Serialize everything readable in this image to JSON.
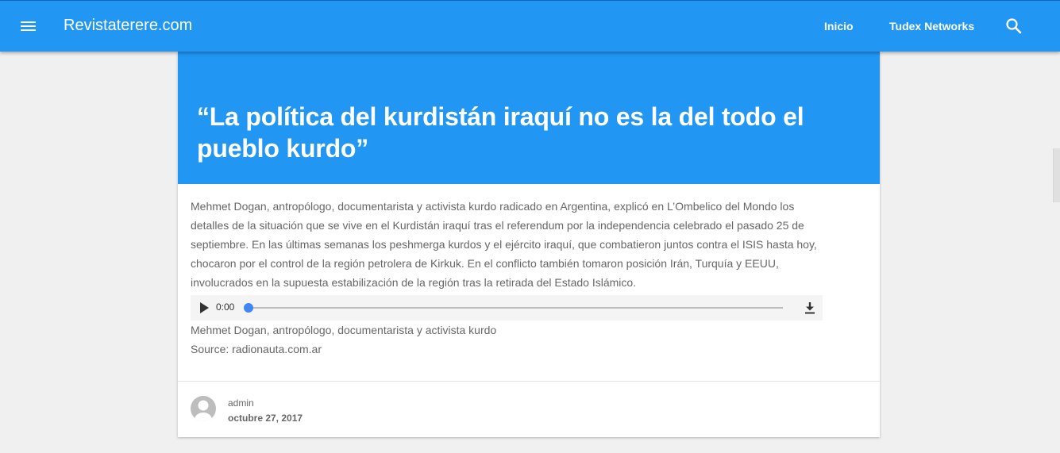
{
  "site": {
    "brand": "Revistaterere.com",
    "nav": {
      "home_label": "Inicio",
      "tudex_label": "Tudex Networks"
    },
    "accent_color": "#2196f3"
  },
  "post": {
    "title": "“La política del kurdistán iraquí no es la del todo el pueblo kurdo”",
    "body": "Mehmet Dogan, antropólogo, documentarista y activista kurdo radicado en Argentina, explicó en L’Ombelico del Mondo los detalles de la situación que se vive en el Kurdistán iraquí tras el referendum por la independencia celebrado el pasado 25 de septiembre. En las últimas semanas los peshmerga kurdos y el ejército iraquí, que combatieron juntos contra el ISIS hasta hoy, chocaron por el control de la región petrolera de Kirkuk. En el conflicto también tomaron posición Irán, Turquía y EEUU, involucrados en la supuesta estabilización de la región tras la retirada del Estado Islámico.",
    "audio": {
      "time": "0:00",
      "progress": 0
    },
    "caption": "Mehmet Dogan, antropólogo, documentarista y activista kurdo",
    "source": "Source: radionauta.com.ar",
    "author": "admin",
    "date": "octubre 27, 2017"
  },
  "icons": [
    "menu-icon",
    "search-icon",
    "play-icon",
    "download-icon",
    "avatar-icon"
  ]
}
